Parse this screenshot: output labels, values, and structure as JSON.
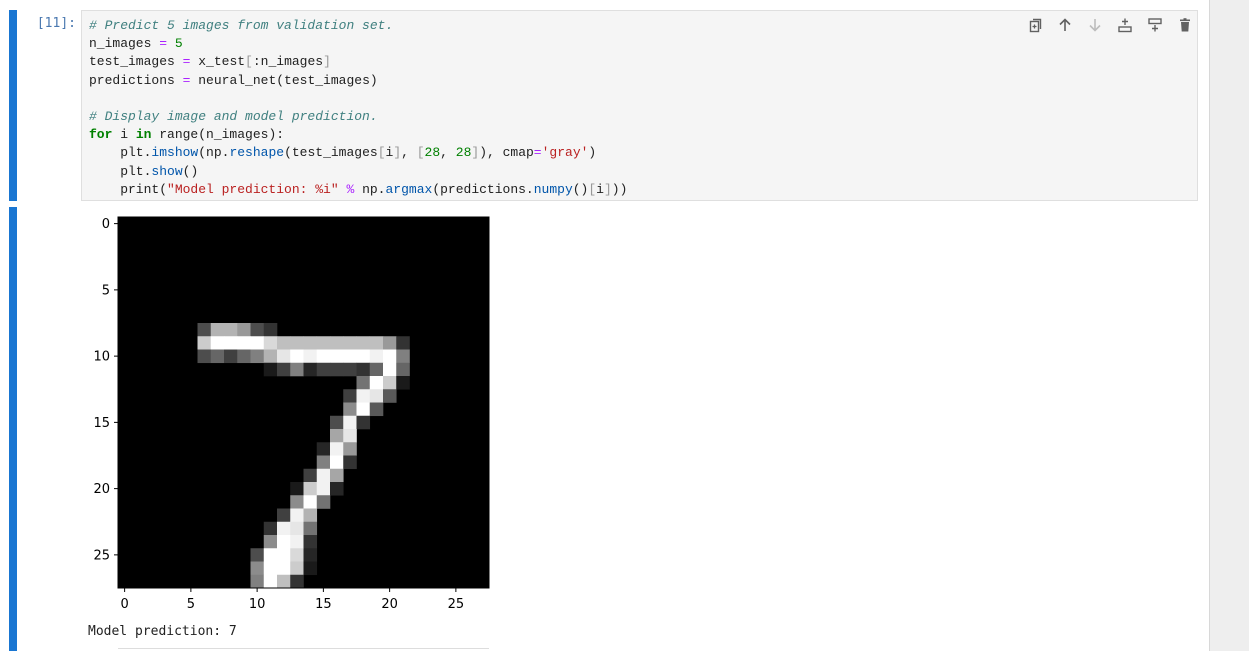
{
  "cell": {
    "prompt": "[11]:",
    "code_lines": [
      [
        {
          "t": "# Predict 5 images from validation set.",
          "c": "cm"
        }
      ],
      [
        {
          "t": "n_images "
        },
        {
          "t": "=",
          "c": "op"
        },
        {
          "t": " "
        },
        {
          "t": "5",
          "c": "num"
        }
      ],
      [
        {
          "t": "test_images "
        },
        {
          "t": "=",
          "c": "op"
        },
        {
          "t": " x_test"
        },
        {
          "t": "[",
          "c": "br"
        },
        {
          "t": ":n_images"
        },
        {
          "t": "]",
          "c": "br"
        }
      ],
      [
        {
          "t": "predictions "
        },
        {
          "t": "=",
          "c": "op"
        },
        {
          "t": " neural_net(test_images)"
        }
      ],
      [],
      [
        {
          "t": "# Display image and model prediction.",
          "c": "cm"
        }
      ],
      [
        {
          "t": "for",
          "c": "kw"
        },
        {
          "t": " i "
        },
        {
          "t": "in",
          "c": "kw"
        },
        {
          "t": " range(n_images):"
        }
      ],
      [
        {
          "t": "    plt."
        },
        {
          "t": "imshow",
          "c": "fn"
        },
        {
          "t": "(np."
        },
        {
          "t": "reshape",
          "c": "fn"
        },
        {
          "t": "(test_images"
        },
        {
          "t": "[",
          "c": "br"
        },
        {
          "t": "i"
        },
        {
          "t": "]",
          "c": "br"
        },
        {
          "t": ", "
        },
        {
          "t": "[",
          "c": "br"
        },
        {
          "t": "28",
          "c": "num"
        },
        {
          "t": ", "
        },
        {
          "t": "28",
          "c": "num"
        },
        {
          "t": "]",
          "c": "br"
        },
        {
          "t": "), cmap"
        },
        {
          "t": "=",
          "c": "op"
        },
        {
          "t": "'gray'",
          "c": "str"
        },
        {
          "t": ")"
        }
      ],
      [
        {
          "t": "    plt."
        },
        {
          "t": "show",
          "c": "fn"
        },
        {
          "t": "()"
        }
      ],
      [
        {
          "t": "    print("
        },
        {
          "t": "\"Model prediction: %i\"",
          "c": "str"
        },
        {
          "t": " "
        },
        {
          "t": "%",
          "c": "op"
        },
        {
          "t": " np."
        },
        {
          "t": "argmax",
          "c": "fn"
        },
        {
          "t": "(predictions."
        },
        {
          "t": "numpy",
          "c": "fn"
        },
        {
          "t": "()"
        },
        {
          "t": "[",
          "c": "br"
        },
        {
          "t": "i"
        },
        {
          "t": "]",
          "c": "br"
        },
        {
          "t": "))"
        }
      ]
    ]
  },
  "toolbar": {
    "icons": [
      "duplicate-cell-icon",
      "move-cell-up-icon",
      "move-cell-down-icon",
      "insert-cell-above-icon",
      "insert-cell-below-icon",
      "delete-cell-icon"
    ]
  },
  "output": {
    "prediction_text": "Model prediction: 7",
    "image": {
      "colormap": "gray",
      "size": 28,
      "xticks": [
        "0",
        "5",
        "10",
        "15",
        "20",
        "25"
      ],
      "yticks": [
        "0",
        "5",
        "10",
        "15",
        "20",
        "25"
      ],
      "pixels": [
        [
          8,
          6,
          0.3
        ],
        [
          8,
          7,
          0.7
        ],
        [
          8,
          8,
          0.7
        ],
        [
          8,
          9,
          0.6
        ],
        [
          8,
          10,
          0.3
        ],
        [
          8,
          11,
          0.2
        ],
        [
          9,
          6,
          0.8
        ],
        [
          9,
          7,
          1
        ],
        [
          9,
          8,
          1
        ],
        [
          9,
          9,
          1
        ],
        [
          9,
          10,
          1
        ],
        [
          9,
          11,
          0.85
        ],
        [
          9,
          12,
          0.75
        ],
        [
          9,
          13,
          0.75
        ],
        [
          9,
          14,
          0.75
        ],
        [
          9,
          15,
          0.75
        ],
        [
          9,
          16,
          0.75
        ],
        [
          9,
          17,
          0.75
        ],
        [
          9,
          18,
          0.75
        ],
        [
          9,
          19,
          0.75
        ],
        [
          9,
          20,
          0.6
        ],
        [
          9,
          21,
          0.2
        ],
        [
          10,
          6,
          0.3
        ],
        [
          10,
          7,
          0.4
        ],
        [
          10,
          8,
          0.25
        ],
        [
          10,
          9,
          0.4
        ],
        [
          10,
          10,
          0.5
        ],
        [
          10,
          11,
          0.7
        ],
        [
          10,
          12,
          0.9
        ],
        [
          10,
          13,
          1
        ],
        [
          10,
          14,
          0.95
        ],
        [
          10,
          15,
          1
        ],
        [
          10,
          16,
          1
        ],
        [
          10,
          17,
          1
        ],
        [
          10,
          18,
          1
        ],
        [
          10,
          19,
          0.95
        ],
        [
          10,
          20,
          1
        ],
        [
          10,
          21,
          0.5
        ],
        [
          11,
          11,
          0.1
        ],
        [
          11,
          12,
          0.25
        ],
        [
          11,
          13,
          0.5
        ],
        [
          11,
          14,
          0.15
        ],
        [
          11,
          15,
          0.25
        ],
        [
          11,
          16,
          0.25
        ],
        [
          11,
          17,
          0.25
        ],
        [
          11,
          18,
          0.2
        ],
        [
          11,
          19,
          0.4
        ],
        [
          11,
          20,
          1
        ],
        [
          11,
          21,
          0.4
        ],
        [
          12,
          18,
          0.45
        ],
        [
          12,
          19,
          1
        ],
        [
          12,
          20,
          0.8
        ],
        [
          12,
          21,
          0.1
        ],
        [
          13,
          17,
          0.25
        ],
        [
          13,
          18,
          0.95
        ],
        [
          13,
          19,
          0.9
        ],
        [
          13,
          20,
          0.35
        ],
        [
          14,
          17,
          0.55
        ],
        [
          14,
          18,
          1
        ],
        [
          14,
          19,
          0.35
        ],
        [
          15,
          16,
          0.3
        ],
        [
          15,
          17,
          0.95
        ],
        [
          15,
          18,
          0.2
        ],
        [
          16,
          16,
          0.65
        ],
        [
          16,
          17,
          0.9
        ],
        [
          17,
          15,
          0.15
        ],
        [
          17,
          16,
          0.95
        ],
        [
          17,
          17,
          0.6
        ],
        [
          18,
          15,
          0.5
        ],
        [
          18,
          16,
          1
        ],
        [
          18,
          17,
          0.2
        ],
        [
          19,
          14,
          0.25
        ],
        [
          19,
          15,
          0.95
        ],
        [
          19,
          16,
          0.65
        ],
        [
          20,
          13,
          0.1
        ],
        [
          20,
          14,
          0.8
        ],
        [
          20,
          15,
          0.95
        ],
        [
          20,
          16,
          0.15
        ],
        [
          21,
          13,
          0.55
        ],
        [
          21,
          14,
          1
        ],
        [
          21,
          15,
          0.45
        ],
        [
          22,
          12,
          0.25
        ],
        [
          22,
          13,
          0.95
        ],
        [
          22,
          14,
          0.7
        ],
        [
          23,
          11,
          0.2
        ],
        [
          23,
          12,
          0.95
        ],
        [
          23,
          13,
          0.9
        ],
        [
          23,
          14,
          0.45
        ],
        [
          24,
          11,
          0.55
        ],
        [
          24,
          12,
          1
        ],
        [
          24,
          13,
          0.95
        ],
        [
          24,
          14,
          0.2
        ],
        [
          25,
          10,
          0.3
        ],
        [
          25,
          11,
          1
        ],
        [
          25,
          12,
          1
        ],
        [
          25,
          13,
          0.85
        ],
        [
          25,
          14,
          0.15
        ],
        [
          26,
          10,
          0.55
        ],
        [
          26,
          11,
          1
        ],
        [
          26,
          12,
          1
        ],
        [
          26,
          13,
          0.8
        ],
        [
          26,
          14,
          0.1
        ],
        [
          27,
          10,
          0.5
        ],
        [
          27,
          11,
          1
        ],
        [
          27,
          12,
          0.75
        ],
        [
          27,
          13,
          0.2
        ]
      ]
    }
  }
}
